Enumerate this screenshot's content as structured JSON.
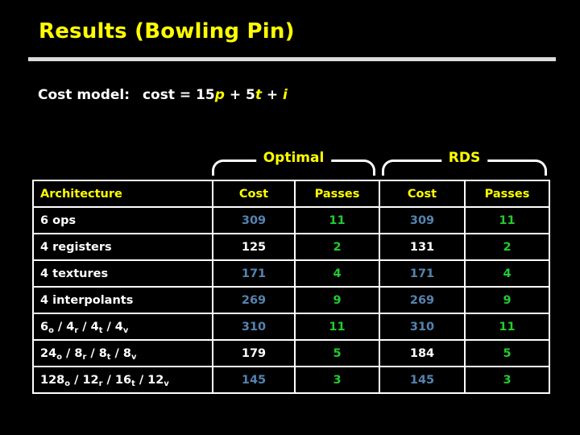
{
  "slide": {
    "title": "Results (Bowling Pin)",
    "cost_model": {
      "label": "Cost model:",
      "expr_prefix": "cost = 15",
      "var1": "p",
      "plus1": "+ 5",
      "var2": "t",
      "plus2": "+",
      "var3": "i",
      "full_text": "Cost model:  cost = 15p + 5t + i"
    }
  },
  "colors": {
    "background": "#000000",
    "title": "#ffff00",
    "rule": "#dcdcdc",
    "header_text": "#ffff00",
    "arch_text": "#ffffff",
    "cost_value": "#5583b0",
    "passes_value": "#22cc2e",
    "highlight_bg": "#8c8c8c",
    "highlight_text": "#ffffff",
    "grid": "#ffffff"
  },
  "groups": [
    {
      "label": "Optimal"
    },
    {
      "label": "RDS"
    }
  ],
  "table": {
    "headers": [
      "Architecture",
      "Cost",
      "Passes",
      "Cost",
      "Passes"
    ],
    "rows": [
      {
        "arch": "6 ops",
        "arch_parts": [
          {
            "t": "6 ops",
            "sub": ""
          }
        ],
        "opt_cost": "309",
        "opt_passes": "11",
        "rds_cost": "309",
        "rds_passes": "11",
        "opt_cost_hl": false,
        "rds_cost_hl": false
      },
      {
        "arch": "4 registers",
        "arch_parts": [
          {
            "t": "4 registers",
            "sub": ""
          }
        ],
        "opt_cost": "125",
        "opt_passes": "2",
        "rds_cost": "131",
        "rds_passes": "2",
        "opt_cost_hl": true,
        "rds_cost_hl": true
      },
      {
        "arch": "4 textures",
        "arch_parts": [
          {
            "t": "4 textures",
            "sub": ""
          }
        ],
        "opt_cost": "171",
        "opt_passes": "4",
        "rds_cost": "171",
        "rds_passes": "4",
        "opt_cost_hl": false,
        "rds_cost_hl": false
      },
      {
        "arch": "4 interpolants",
        "arch_parts": [
          {
            "t": "4 interpolants",
            "sub": ""
          }
        ],
        "opt_cost": "269",
        "opt_passes": "9",
        "rds_cost": "269",
        "rds_passes": "9",
        "opt_cost_hl": false,
        "rds_cost_hl": false
      },
      {
        "arch": "6o / 4r / 4t / 4v",
        "arch_parts": [
          {
            "t": "6",
            "sub": "o"
          },
          {
            "t": " / 4",
            "sub": "r"
          },
          {
            "t": " / 4",
            "sub": "t"
          },
          {
            "t": " / 4",
            "sub": "v"
          }
        ],
        "opt_cost": "310",
        "opt_passes": "11",
        "rds_cost": "310",
        "rds_passes": "11",
        "opt_cost_hl": false,
        "rds_cost_hl": false
      },
      {
        "arch": "24o / 8r / 8t / 8v",
        "arch_parts": [
          {
            "t": "24",
            "sub": "o"
          },
          {
            "t": " / 8",
            "sub": "r"
          },
          {
            "t": " / 8",
            "sub": "t"
          },
          {
            "t": " / 8",
            "sub": "v"
          }
        ],
        "opt_cost": "179",
        "opt_passes": "5",
        "rds_cost": "184",
        "rds_passes": "5",
        "opt_cost_hl": true,
        "rds_cost_hl": true
      },
      {
        "arch": "128o / 12r / 16t / 12v",
        "arch_parts": [
          {
            "t": "128",
            "sub": "o"
          },
          {
            "t": " / 12",
            "sub": "r"
          },
          {
            "t": " / 16",
            "sub": "t"
          },
          {
            "t": " / 12",
            "sub": "v"
          }
        ],
        "opt_cost": "145",
        "opt_passes": "3",
        "rds_cost": "145",
        "rds_passes": "3",
        "opt_cost_hl": false,
        "rds_cost_hl": false
      }
    ]
  }
}
